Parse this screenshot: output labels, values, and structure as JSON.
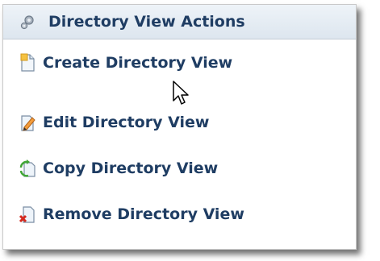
{
  "panel": {
    "title": "Directory View Actions",
    "title_icon": "gear-icon",
    "accent_color": "#1f3d63"
  },
  "actions": [
    {
      "label": "Create Directory View",
      "icon": "new-document-icon"
    },
    {
      "label": "Edit Directory View",
      "icon": "edit-document-icon"
    },
    {
      "label": "Copy Directory View",
      "icon": "copy-document-icon"
    },
    {
      "label": "Remove Directory View",
      "icon": "remove-document-icon"
    }
  ],
  "cursor_icon": "mouse-pointer-icon"
}
